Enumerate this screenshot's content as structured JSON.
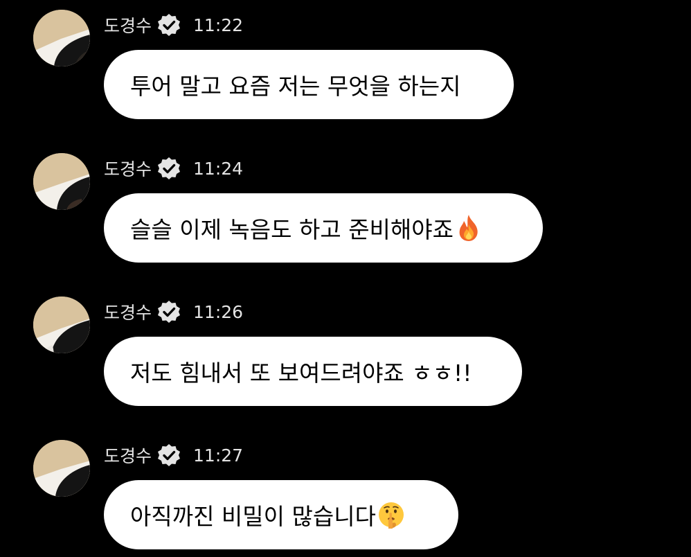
{
  "messages": [
    {
      "sender": "도경수",
      "time": "11:22",
      "verified_icon": "verified-badge-icon",
      "text": "투어 말고 요즘 저는 무엇을 하는지",
      "emoji": null
    },
    {
      "sender": "도경수",
      "time": "11:24",
      "verified_icon": "verified-badge-icon",
      "text": "슬슬 이제 녹음도 하고 준비해야죠",
      "emoji": "fire-emoji-icon"
    },
    {
      "sender": "도경수",
      "time": "11:26",
      "verified_icon": "verified-badge-icon",
      "text": "저도 힘내서 또 보여드려야죠 ㅎㅎ!!",
      "emoji": null
    },
    {
      "sender": "도경수",
      "time": "11:27",
      "verified_icon": "verified-badge-icon",
      "text": "아직까진 비밀이 많습니다",
      "emoji": "shushing-face-emoji-icon"
    }
  ],
  "colors": {
    "background": "#000000",
    "bubble": "#ffffff",
    "bubble_text": "#000000",
    "meta_text": "#e4e4e4",
    "verified_badge": "#e4e4e4"
  }
}
